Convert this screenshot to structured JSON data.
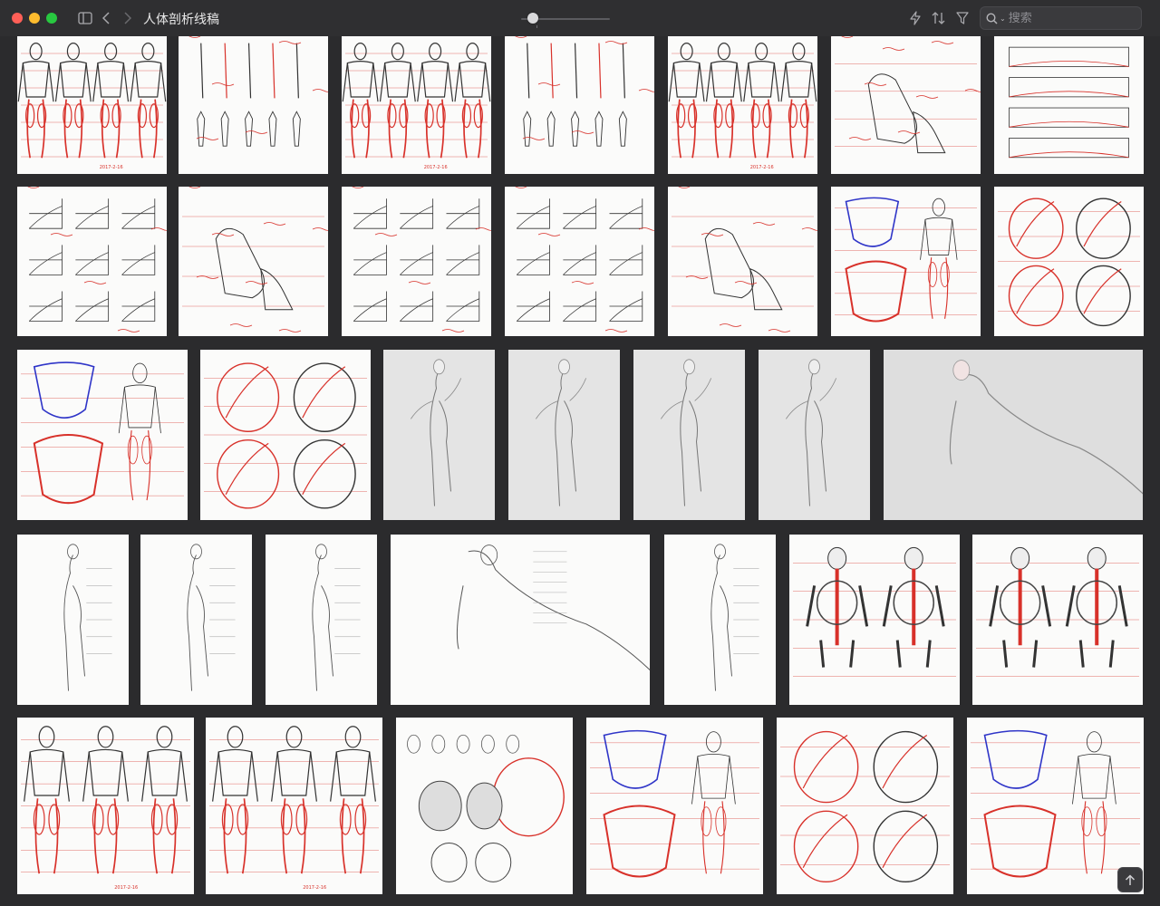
{
  "window": {
    "title": "人体剖析线稿"
  },
  "search": {
    "placeholder": "搜索"
  },
  "icons": {
    "sidebar": "sidebar-toggle-icon",
    "back": "chevron-left-icon",
    "forward": "chevron-right-icon",
    "bolt": "bolt-icon",
    "sort": "sort-icon",
    "filter": "filter-icon",
    "search": "magnifier-icon",
    "scroll_top": "arrow-up-icon"
  },
  "zoom": {
    "level": 0.13
  },
  "colors": {
    "background": "#2b2b2d",
    "toolbar": "#2f2f31",
    "sketch_red": "#d8312a",
    "sketch_blue": "#2f35c8",
    "sketch_ink": "#333333"
  },
  "thumbnails": [
    {
      "kind": "red-figures"
    },
    {
      "kind": "bones"
    },
    {
      "kind": "red-figures"
    },
    {
      "kind": "bones"
    },
    {
      "kind": "red-figures"
    },
    {
      "kind": "foot"
    },
    {
      "kind": "diagram"
    },
    {
      "kind": "grid-sketch"
    },
    {
      "kind": "foot"
    },
    {
      "kind": "grid-sketch"
    },
    {
      "kind": "grid-sketch"
    },
    {
      "kind": "foot"
    },
    {
      "kind": "pelvis-blue"
    },
    {
      "kind": "red-circles"
    },
    {
      "kind": "pelvis-blue"
    },
    {
      "kind": "red-circles"
    },
    {
      "kind": "pose-grey"
    },
    {
      "kind": "pose-grey"
    },
    {
      "kind": "pose-grey"
    },
    {
      "kind": "pose-grey"
    },
    {
      "kind": "recline-grey"
    },
    {
      "kind": "pose"
    },
    {
      "kind": "pose"
    },
    {
      "kind": "pose"
    },
    {
      "kind": "recline"
    },
    {
      "kind": "pose"
    },
    {
      "kind": "skeleton"
    },
    {
      "kind": "skeleton"
    },
    {
      "kind": "red-figures"
    },
    {
      "kind": "red-figures"
    },
    {
      "kind": "heads"
    },
    {
      "kind": "pelvis-blue"
    },
    {
      "kind": "red-circles"
    },
    {
      "kind": "pelvis-blue"
    }
  ]
}
